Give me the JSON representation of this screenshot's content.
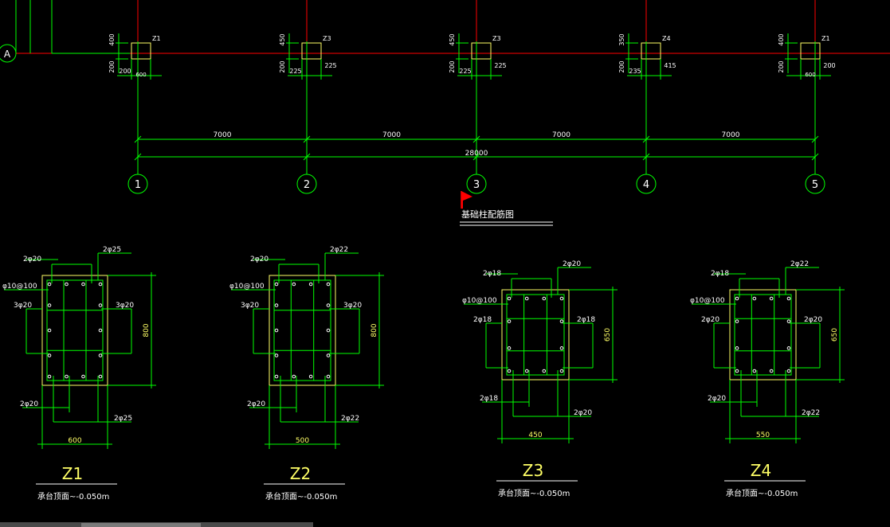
{
  "plan": {
    "axis_row": "A",
    "axes": [
      "1",
      "2",
      "3",
      "4",
      "5"
    ],
    "spans": [
      "7000",
      "7000",
      "7000",
      "7000"
    ],
    "total": "28000",
    "columns": [
      {
        "tag": "Z1",
        "top": "400",
        "bottom": "200",
        "left": "200",
        "width": "600",
        "right": ""
      },
      {
        "tag": "Z3",
        "top": "450",
        "bottom": "200",
        "left": "225",
        "width": "",
        "right": "225"
      },
      {
        "tag": "Z3",
        "top": "450",
        "bottom": "200",
        "left": "225",
        "width": "",
        "right": "225"
      },
      {
        "tag": "Z4",
        "top": "350",
        "bottom": "200",
        "left": "235",
        "width": "",
        "right": "415"
      },
      {
        "tag": "Z1",
        "top": "400",
        "bottom": "200",
        "left": "",
        "width": "600",
        "right": "200"
      }
    ]
  },
  "drawing_title": "基础柱配筋图",
  "sections": [
    {
      "name": "Z1",
      "top_bar": "2φ20",
      "corner_bar": "2φ25",
      "stirrup": "φ10@100",
      "side_left": "3φ20",
      "side_right": "3φ20",
      "bottom_left": "2φ20",
      "bottom_right": "2φ25",
      "width": "600",
      "height": "800",
      "caption": "承台顶面~-0.050m"
    },
    {
      "name": "Z2",
      "top_bar": "2φ20",
      "corner_bar": "2φ22",
      "stirrup": "φ10@100",
      "side_left": "3φ20",
      "side_right": "3φ20",
      "bottom_left": "2φ20",
      "bottom_right": "2φ22",
      "width": "500",
      "height": "800",
      "caption": "承台顶面~-0.050m"
    },
    {
      "name": "Z3",
      "top_bar": "2φ18",
      "corner_bar": "2φ20",
      "stirrup": "φ10@100",
      "side_left": "2φ18",
      "side_right": "2φ18",
      "bottom_left": "2φ18",
      "bottom_right": "2φ20",
      "width": "450",
      "height": "650",
      "caption": "承台顶面~-0.050m"
    },
    {
      "name": "Z4",
      "top_bar": "2φ18",
      "corner_bar": "2φ22",
      "stirrup": "φ10@100",
      "side_left": "2φ20",
      "side_right": "2φ20",
      "bottom_left": "2φ20",
      "bottom_right": "2φ22",
      "width": "550",
      "height": "650",
      "caption": "承台顶面~-0.050m"
    }
  ],
  "colors": {
    "background": "#000000",
    "dim": "#00ff00",
    "axis": "#ff0000",
    "column": "#ffff66",
    "text": "#ffffff",
    "flag": "#ff0000"
  }
}
